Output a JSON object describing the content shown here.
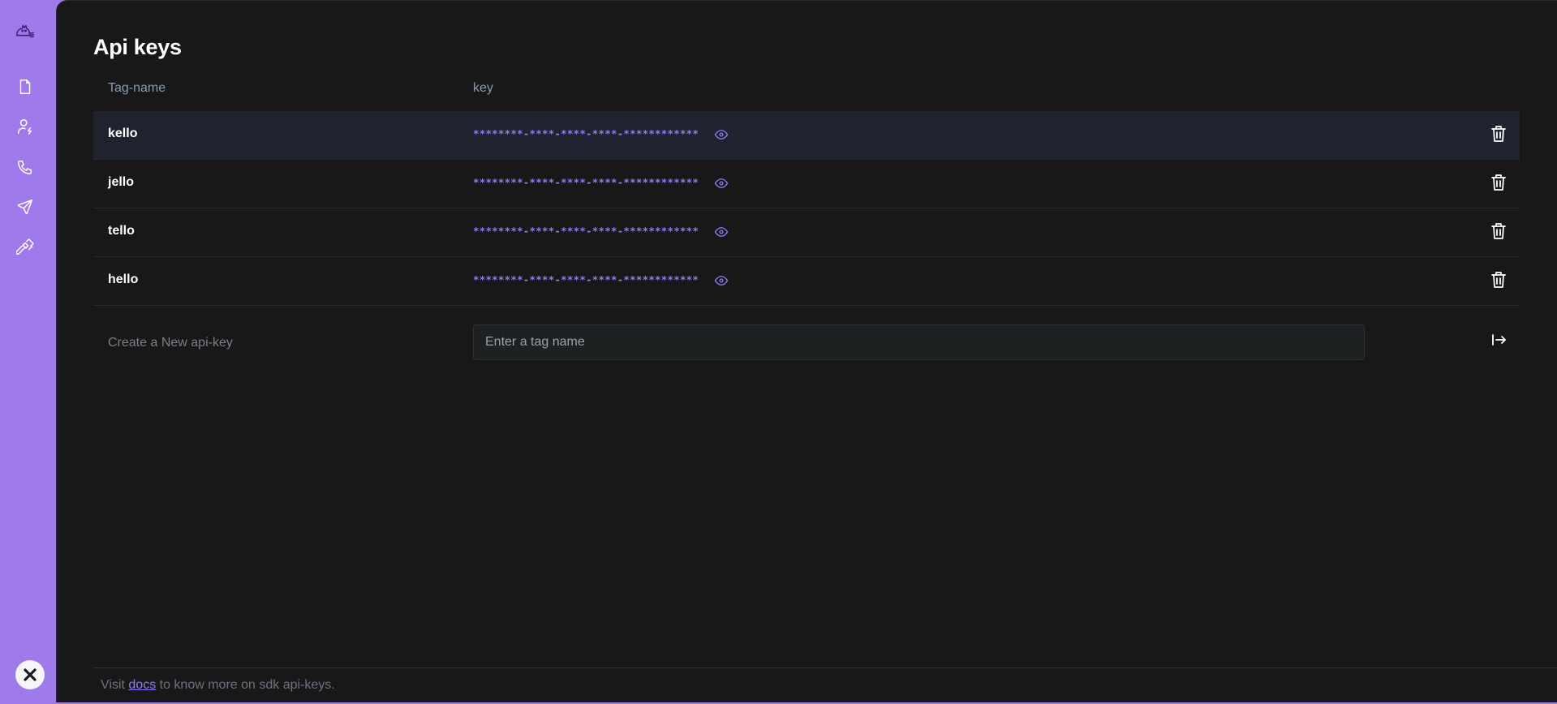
{
  "page": {
    "title": "Api keys"
  },
  "sidebar": {
    "logo_icon": "cat-logo-icon",
    "items": [
      {
        "icon": "file-icon"
      },
      {
        "icon": "user-bolt-icon"
      },
      {
        "icon": "phone-icon"
      },
      {
        "icon": "send-icon"
      },
      {
        "icon": "hammer-icon"
      }
    ],
    "close_icon": "close-icon"
  },
  "table": {
    "headers": {
      "tag": "Tag-name",
      "key": "key"
    },
    "rows": [
      {
        "name": "kello",
        "key": "********-****-****-****-************"
      },
      {
        "name": "jello",
        "key": "********-****-****-****-************"
      },
      {
        "name": "tello",
        "key": "********-****-****-****-************"
      },
      {
        "name": "hello",
        "key": "********-****-****-****-************"
      }
    ]
  },
  "create": {
    "label": "Create a New api-key",
    "placeholder": "Enter a tag name",
    "value": ""
  },
  "footer": {
    "prefix": "Visit",
    "link": "docs",
    "suffix": "to know more on sdk api-keys."
  },
  "colors": {
    "sidebar": "#9f7aea",
    "background": "#181818",
    "accent": "#8b7cf8",
    "active_row": "#1f2330"
  }
}
